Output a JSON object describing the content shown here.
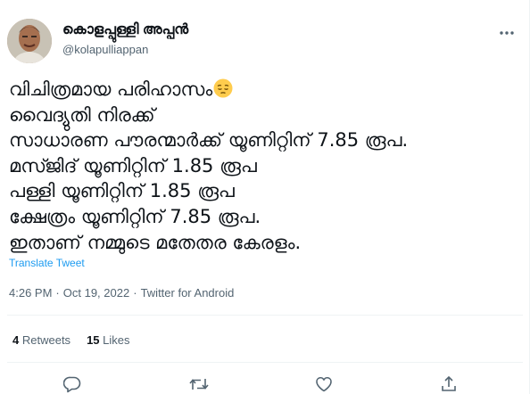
{
  "tweet": {
    "display_name": "കൊളപ്പുള്ളി അപ്പൻ",
    "handle": "@kolapulliappan",
    "lines": [
      "വിചിത്രമായ പരിഹാസം",
      " വൈദ്യുതി നിരക്ക്",
      " സാധാരണ പൗരന്മാർക്ക് യൂണിറ്റിന് 7.85 രൂപ.",
      " മസ്ജിദ് യൂണിറ്റിന് 1.85 രൂപ",
      " പള്ളി യൂണിറ്റിന് 1.85 രൂപ",
      " ക്ഷേത്രം യൂണിറ്റിന് 7.85 രൂപ.",
      " ഇതാണ് നമ്മുടെ മതേതര കേരളം."
    ],
    "emoji": "pensive-face",
    "translate_label": "Translate Tweet",
    "time": "4:26 PM",
    "date": "Oct 19, 2022",
    "separator": "·",
    "source": "Twitter for Android",
    "retweets_count": "4",
    "retweets_label": "Retweets",
    "likes_count": "15",
    "likes_label": "Likes"
  },
  "colors": {
    "text": "#0f1419",
    "secondary": "#536471",
    "link": "#1d9bf0",
    "divider": "#eff3f4"
  },
  "icons": {
    "more": "more-dots-icon",
    "reply": "reply-icon",
    "retweet": "retweet-icon",
    "like": "heart-icon",
    "share": "share-icon"
  }
}
